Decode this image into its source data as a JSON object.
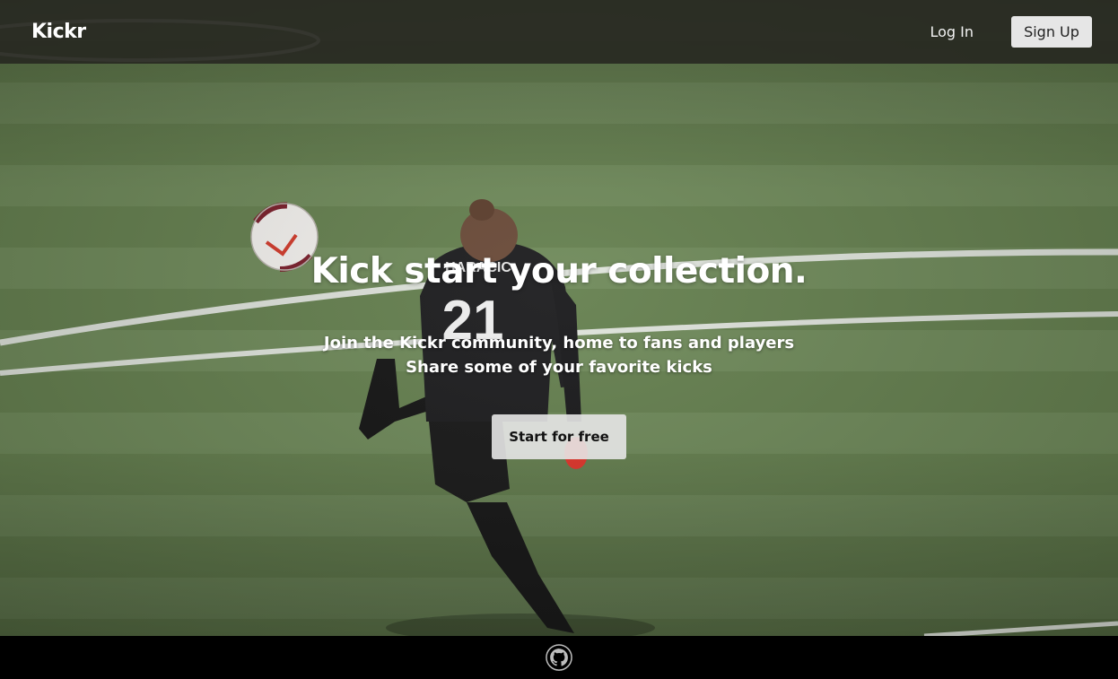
{
  "navbar": {
    "brand": "Kickr",
    "login_label": "Log In",
    "signup_label": "Sign Up"
  },
  "hero": {
    "headline": "Kick start your collection.",
    "subline_1": "Join the Kickr community, home to fans and players",
    "subline_2": "Share some of your favorite kicks",
    "cta_label": "Start for free",
    "background_image": "soccer-player-kicking-ball-on-field"
  },
  "footer": {
    "icon": "github-icon"
  },
  "colors": {
    "navbar_bg": "#262620",
    "button_bg": "#e6e6e6",
    "footer_bg": "#000000",
    "text": "#ffffff"
  }
}
